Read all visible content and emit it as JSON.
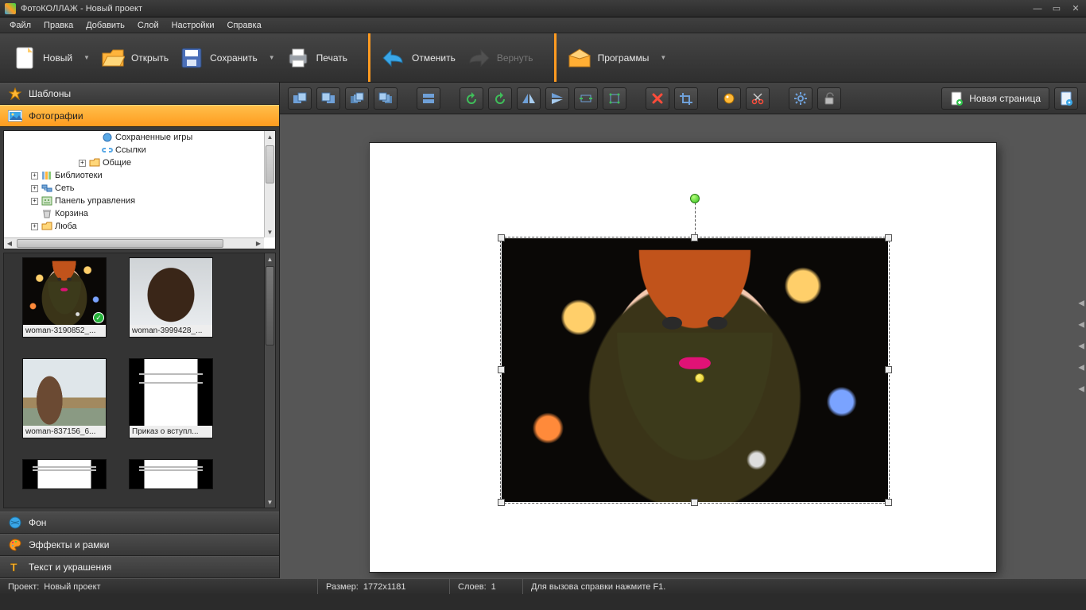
{
  "window": {
    "title": "ФотоКОЛЛАЖ - Новый проект"
  },
  "menubar": [
    "Файл",
    "Правка",
    "Добавить",
    "Слой",
    "Настройки",
    "Справка"
  ],
  "toolbar": {
    "new": "Новый",
    "open": "Открыть",
    "save": "Сохранить",
    "print": "Печать",
    "undo": "Отменить",
    "redo": "Вернуть",
    "programs": "Программы"
  },
  "canvas_toolbar": {
    "new_page": "Новая страница"
  },
  "accordion": {
    "templates": "Шаблоны",
    "photos": "Фотографии",
    "background": "Фон",
    "effects": "Эффекты и рамки",
    "text": "Текст и украшения"
  },
  "folder_tree": [
    {
      "indent": 110,
      "icon": "game",
      "label": "Сохраненные игры",
      "expand": ""
    },
    {
      "indent": 110,
      "icon": "link",
      "label": "Ссылки",
      "expand": ""
    },
    {
      "indent": 94,
      "icon": "folder",
      "label": "Общие",
      "expand": "+"
    },
    {
      "indent": 34,
      "icon": "lib",
      "label": "Библиотеки",
      "expand": "+"
    },
    {
      "indent": 34,
      "icon": "net",
      "label": "Сеть",
      "expand": "+"
    },
    {
      "indent": 34,
      "icon": "panel",
      "label": "Панель управления",
      "expand": "+"
    },
    {
      "indent": 34,
      "icon": "trash",
      "label": "Корзина",
      "expand": ""
    },
    {
      "indent": 34,
      "icon": "folder",
      "label": "Люба",
      "expand": "+"
    }
  ],
  "thumbnails": [
    {
      "label": "woman-3190852_...",
      "kind": "photo1",
      "used": true
    },
    {
      "label": "woman-3999428_...",
      "kind": "photo2",
      "used": false
    },
    {
      "label": "woman-837156_6...",
      "kind": "photo3",
      "used": false
    },
    {
      "label": "Приказ о вступл...",
      "kind": "doc",
      "used": false
    },
    {
      "label": "",
      "kind": "doc2",
      "used": false
    },
    {
      "label": "",
      "kind": "doc2",
      "used": false
    }
  ],
  "status": {
    "project_label": "Проект:",
    "project_name": "Новый проект",
    "size_label": "Размер:",
    "size_value": "1772x1181",
    "layers_label": "Слоев:",
    "layers_value": "1",
    "help_hint": "Для вызова справки нажмите F1."
  }
}
